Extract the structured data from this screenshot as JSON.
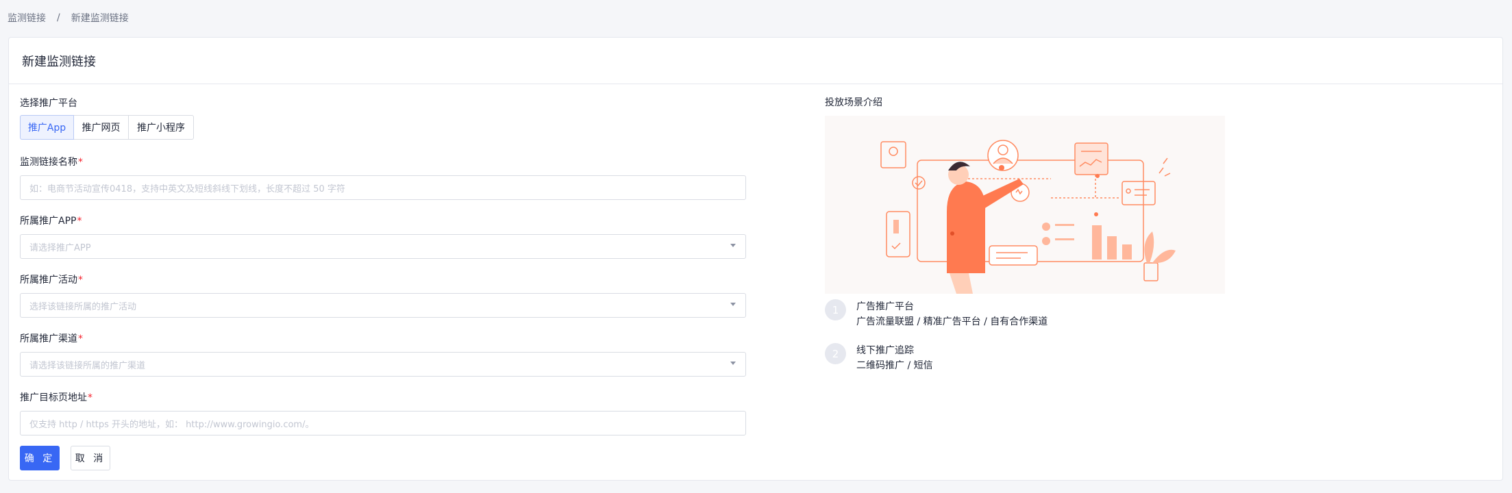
{
  "breadcrumb": {
    "parent": "监测链接",
    "separator": "/",
    "current": "新建监测链接"
  },
  "card": {
    "title": "新建监测链接"
  },
  "form": {
    "platform": {
      "label": "选择推广平台",
      "options": [
        "推广App",
        "推广网页",
        "推广小程序"
      ],
      "selected": "推广App"
    },
    "name": {
      "label": "监测链接名称",
      "required": "*",
      "placeholder": "如：电商节活动宣传0418，支持中英文及短线斜线下划线，长度不超过 50 字符"
    },
    "app": {
      "label": "所属推广APP",
      "required": "*",
      "placeholder": "请选择推广APP"
    },
    "activity": {
      "label": "所属推广活动",
      "required": "*",
      "placeholder": "选择该链接所属的推广活动"
    },
    "channel": {
      "label": "所属推广渠道",
      "required": "*",
      "placeholder": "请选择该链接所属的推广渠道"
    },
    "target": {
      "label": "推广目标页地址",
      "required": "*",
      "placeholder": "仅支持 http / https 开头的地址，如： http://www.growingio.com/。"
    },
    "confirm": "确 定",
    "cancel": "取 消"
  },
  "intro": {
    "title": "投放场景介绍",
    "scenes": [
      {
        "num": "1",
        "title": "广告推广平台",
        "desc": "广告流量联盟 / 精准广告平台 / 自有合作渠道"
      },
      {
        "num": "2",
        "title": "线下推广追踪",
        "desc": "二维码推广 / 短信"
      }
    ]
  },
  "colors": {
    "primary": "#3867f4",
    "illustration": "#ff7a50",
    "required": "#f5222d"
  }
}
